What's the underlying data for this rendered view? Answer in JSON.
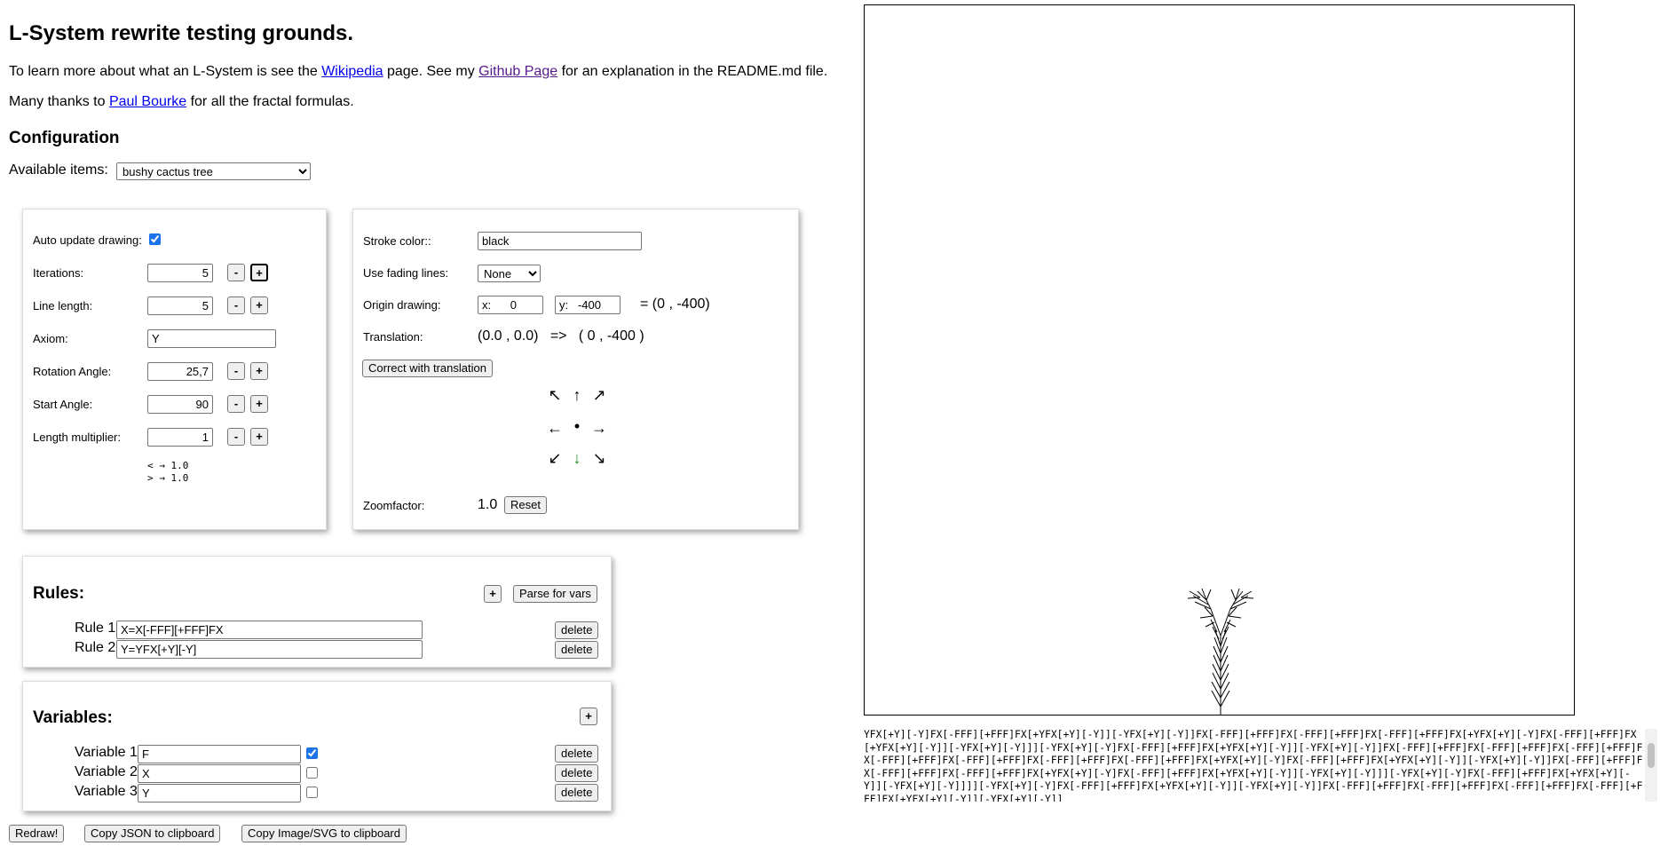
{
  "title": "L-System rewrite testing grounds.",
  "intro": {
    "p1_pre": "To learn more about what an L-System is see the ",
    "p1_link1": "Wikipedia",
    "p1_mid": " page. See my ",
    "p1_link2": "Github Page",
    "p1_post": " for an explanation in the README.md file.",
    "p2_pre": "Many thanks to ",
    "p2_link": "Paul Bourke",
    "p2_post": " for all the fractal formulas."
  },
  "config": {
    "heading": "Configuration",
    "available_label": "Available items:",
    "selected_item": "bushy cactus tree"
  },
  "left_panel": {
    "auto_update_label": "Auto update drawing:",
    "auto_update_checked": true,
    "iterations_label": "Iterations:",
    "iterations_value": "5",
    "line_length_label": "Line length:",
    "line_length_value": "5",
    "axiom_label": "Axiom:",
    "axiom_value": "Y",
    "rotation_label": "Rotation Angle:",
    "rotation_value": "25,7",
    "start_angle_label": "Start Angle:",
    "start_angle_value": "90",
    "length_mult_label": "Length multiplier:",
    "length_mult_value": "1",
    "minus": "-",
    "plus": "+",
    "lt_line": "< → 1.0",
    "gt_line": "> → 1.0"
  },
  "right_panel": {
    "stroke_label": "Stroke color::",
    "stroke_value": "black",
    "fading_label": "Use fading lines:",
    "fading_value": "None",
    "origin_label": "Origin drawing:",
    "origin_x": "x:      0",
    "origin_y": "y:   -400",
    "origin_eq": "= (0 , -400)",
    "translation_label": "Translation:",
    "translation_value": "(0.0 , 0.0)   =>   ( 0 , -400 )",
    "correct_btn": "Correct with translation",
    "arrows": {
      "nw": "↖",
      "n": "↑",
      "ne": "↗",
      "w": "←",
      "c": "•",
      "e": "→",
      "sw": "↙",
      "s": "↓",
      "se": "↘"
    },
    "zoom_label": "Zoomfactor:",
    "zoom_value": "1.0",
    "reset_btn": "Reset"
  },
  "rules": {
    "heading": "Rules:",
    "add_btn": "+",
    "parse_btn": "Parse for vars",
    "items": [
      {
        "label": "Rule 1",
        "value": "X=X[-FFF][+FFF]FX",
        "delete": "delete"
      },
      {
        "label": "Rule 2",
        "value": "Y=YFX[+Y][-Y]",
        "delete": "delete"
      }
    ]
  },
  "variables": {
    "heading": "Variables:",
    "add_btn": "+",
    "items": [
      {
        "label": "Variable 1",
        "value": "F",
        "checked": true,
        "delete": "delete"
      },
      {
        "label": "Variable 2",
        "value": "X",
        "checked": false,
        "delete": "delete"
      },
      {
        "label": "Variable 3",
        "value": "Y",
        "checked": false,
        "delete": "delete"
      }
    ]
  },
  "bottom_buttons": {
    "redraw": "Redraw!",
    "copy_json": "Copy JSON to clipboard",
    "copy_image": "Copy Image/SVG to clipboard"
  },
  "output_text": "YFX[+Y][-Y]FX[-FFF][+FFF]FX[+YFX[+Y][-Y]][-YFX[+Y][-Y]]FX[-FFF][+FFF]FX[-FFF][+FFF]FX[-FFF][+FFF]FX[+YFX[+Y][-Y]FX[-FFF][+FFF]FX[+YFX[+Y][-Y]][-YFX[+Y][-Y]]][-YFX[+Y][-Y]FX[-FFF][+FFF]FX[+YFX[+Y][-Y]][-YFX[+Y][-Y]]FX[-FFF][+FFF]FX[-FFF][+FFF]FX[-FFF][+FFF]FX[-FFF][+FFF]FX[-FFF][+FFF]FX[-FFF][+FFF]FX[-FFF][+FFF]FX[+YFX[+Y][-Y]FX[-FFF][+FFF]FX[+YFX[+Y][-Y]][-YFX[+Y][-Y]]FX[-FFF][+FFF]FX[-FFF][+FFF]FX[-FFF][+FFF]FX[+YFX[+Y][-Y]FX[-FFF][+FFF]FX[+YFX[+Y][-Y]][-YFX[+Y][-Y]]][-YFX[+Y][-Y]FX[-FFF][+FFF]FX[+YFX[+Y][-Y]][-YFX[+Y][-Y]]]][-YFX[+Y][-Y]FX[-FFF][+FFF]FX[+YFX[+Y][-Y]][-YFX[+Y][-Y]]FX[-FFF][+FFF]FX[-FFF][+FFF]FX[-FFF][+FFF]FX[-FFF][+FFF]FX[+YFX[+Y][-Y]][-YFX[+Y][-Y]]"
}
